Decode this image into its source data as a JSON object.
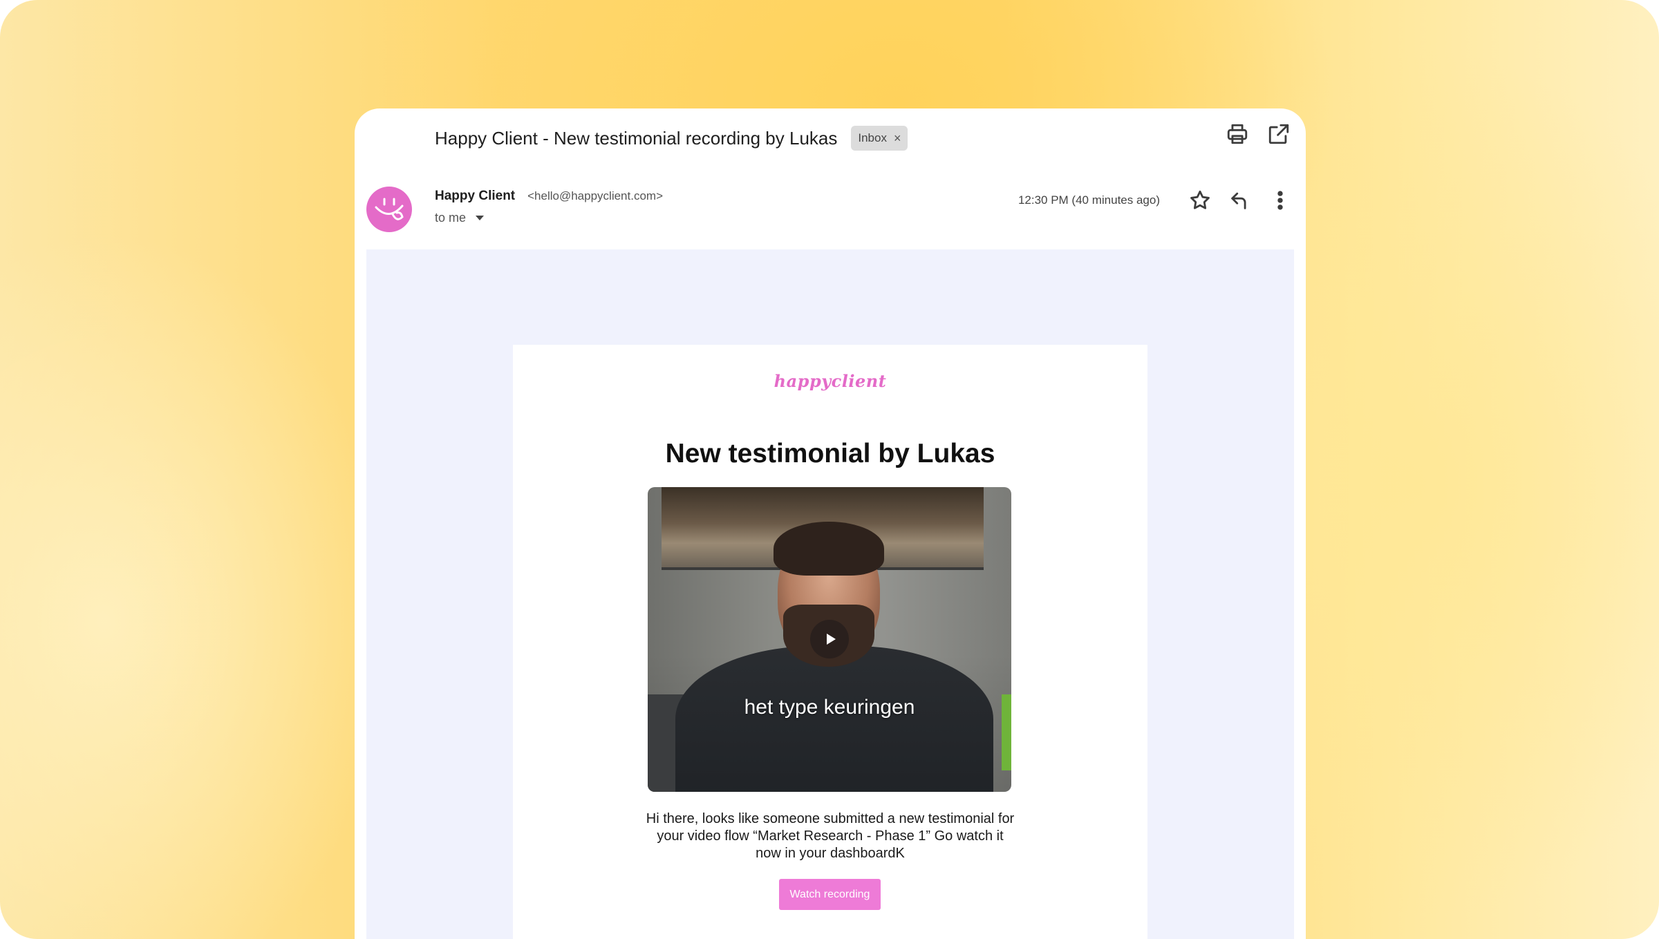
{
  "header": {
    "subject": "Happy Client - New testimonial recording by Lukas",
    "label_chip": "Inbox",
    "label_chip_close": "×"
  },
  "sender": {
    "name": "Happy Client",
    "email": "<hello@happyclient.com>",
    "recipient": "to me",
    "time": "12:30 PM (40 minutes ago)"
  },
  "email": {
    "brand": "happyclient",
    "headline": "New testimonial by Lukas",
    "video_caption": "het type keuringen",
    "body": "Hi there, looks like someone submitted a new testimonial for your video flow “Market Research - Phase 1” Go watch it now in your dashboardK",
    "button_label": "Watch recording"
  },
  "colors": {
    "brand_pink": "#e46bc8",
    "button_pink": "#ee7bd7",
    "body_bg": "#f0f2fd"
  },
  "icons": [
    "print-icon",
    "open-in-new-icon",
    "star-icon",
    "reply-icon",
    "more-vert-icon",
    "smiley-avatar-icon",
    "play-icon"
  ]
}
